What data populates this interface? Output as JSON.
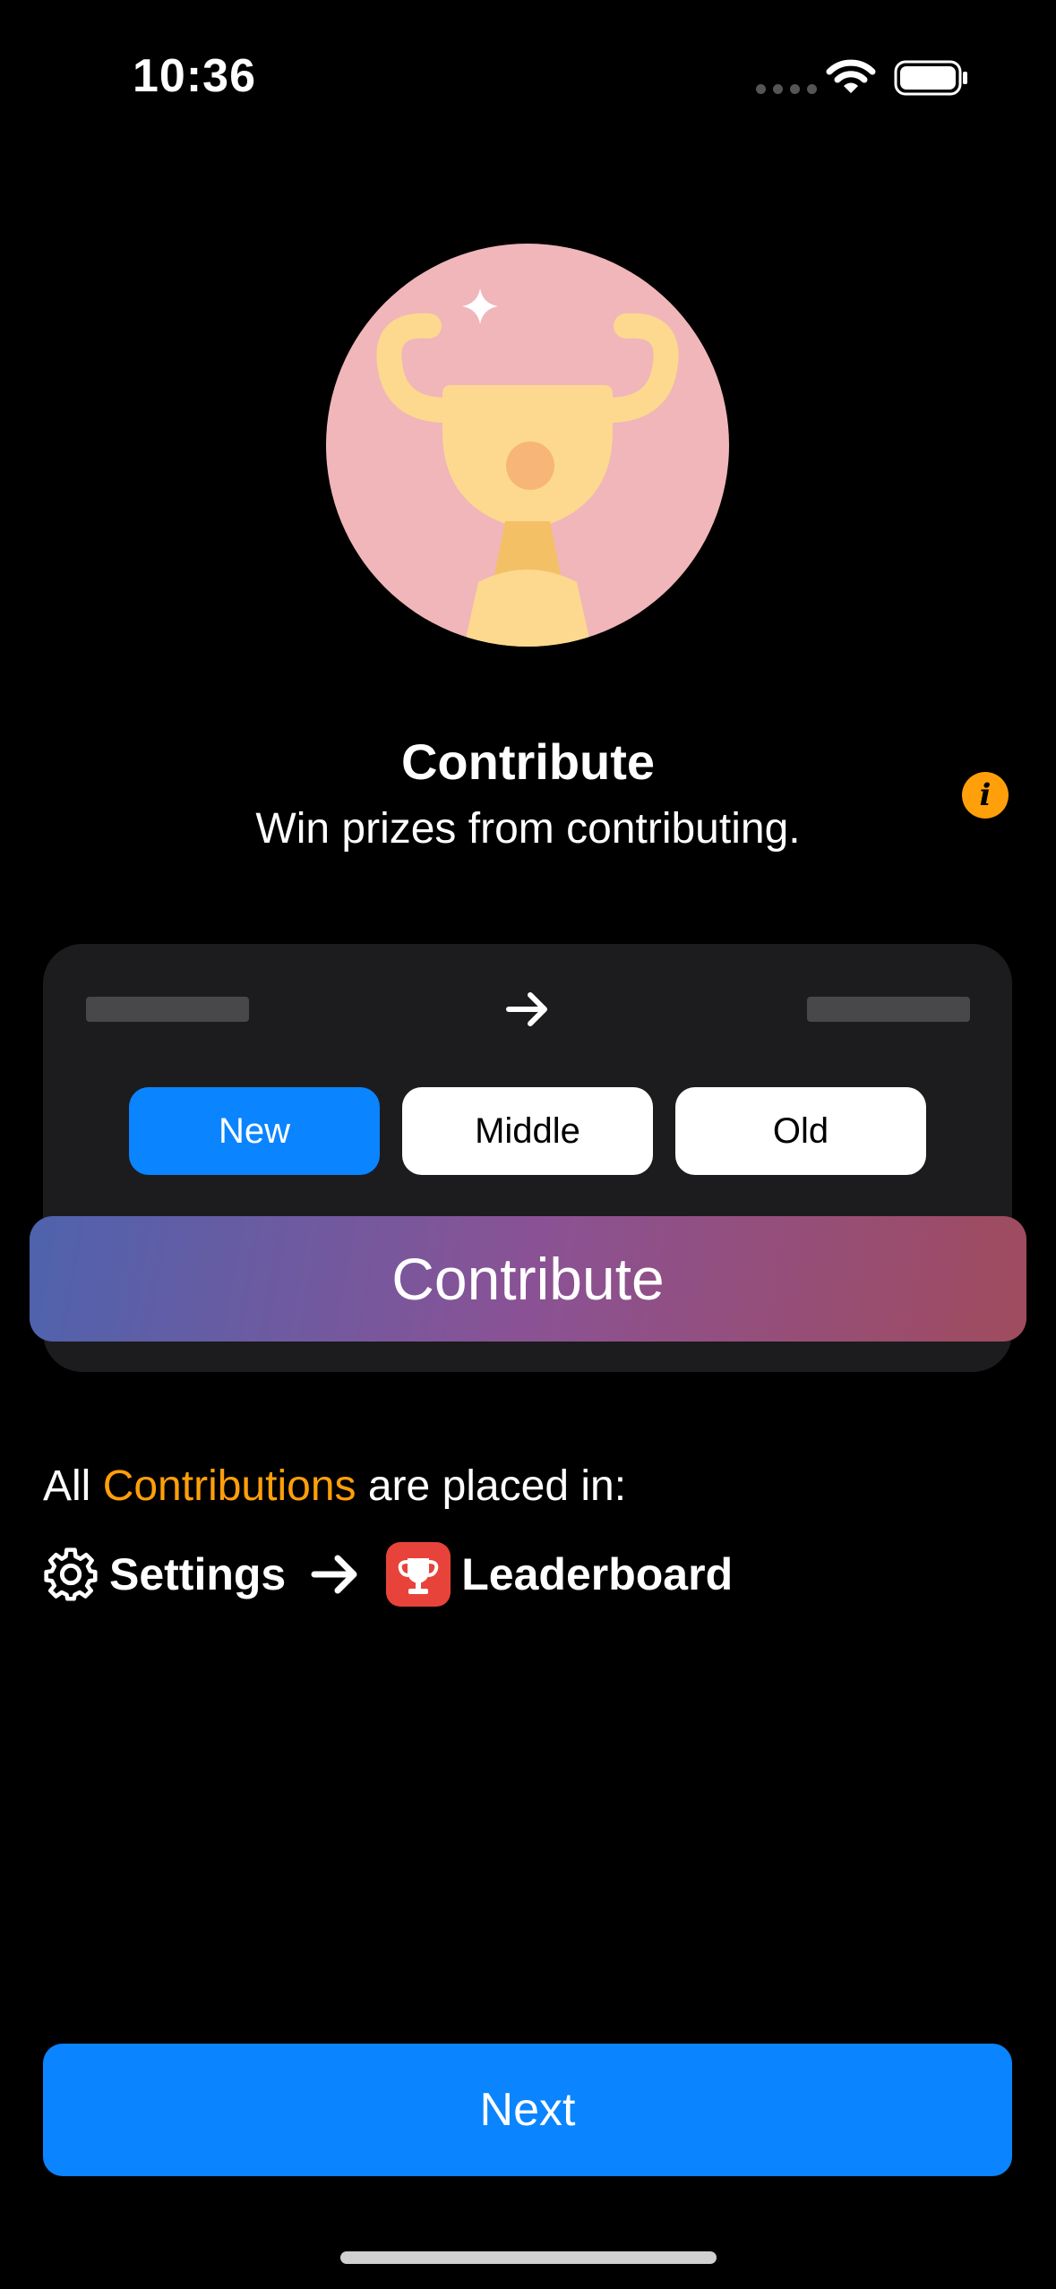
{
  "status_bar": {
    "time": "10:36"
  },
  "hero": {
    "icon": "trophy-illustration",
    "sparkle": "sparkle-icon"
  },
  "header": {
    "title": "Contribute",
    "subtitle": "Win prizes from contributing.",
    "info_icon": "info-icon"
  },
  "card": {
    "segments": [
      {
        "label": "New",
        "selected": true
      },
      {
        "label": "Middle",
        "selected": false
      },
      {
        "label": "Old",
        "selected": false
      }
    ],
    "contribute_label": "Contribute"
  },
  "location": {
    "prefix": "All",
    "highlight": "Contributions",
    "suffix": "are placed in:",
    "settings_label": "Settings",
    "leaderboard_label": "Leaderboard"
  },
  "footer": {
    "next_label": "Next"
  },
  "colors": {
    "accent": "#0a84ff",
    "orange": "#ff9f0a",
    "hero_bg": "#f0b6b9",
    "trophy": "#fcd98f"
  }
}
